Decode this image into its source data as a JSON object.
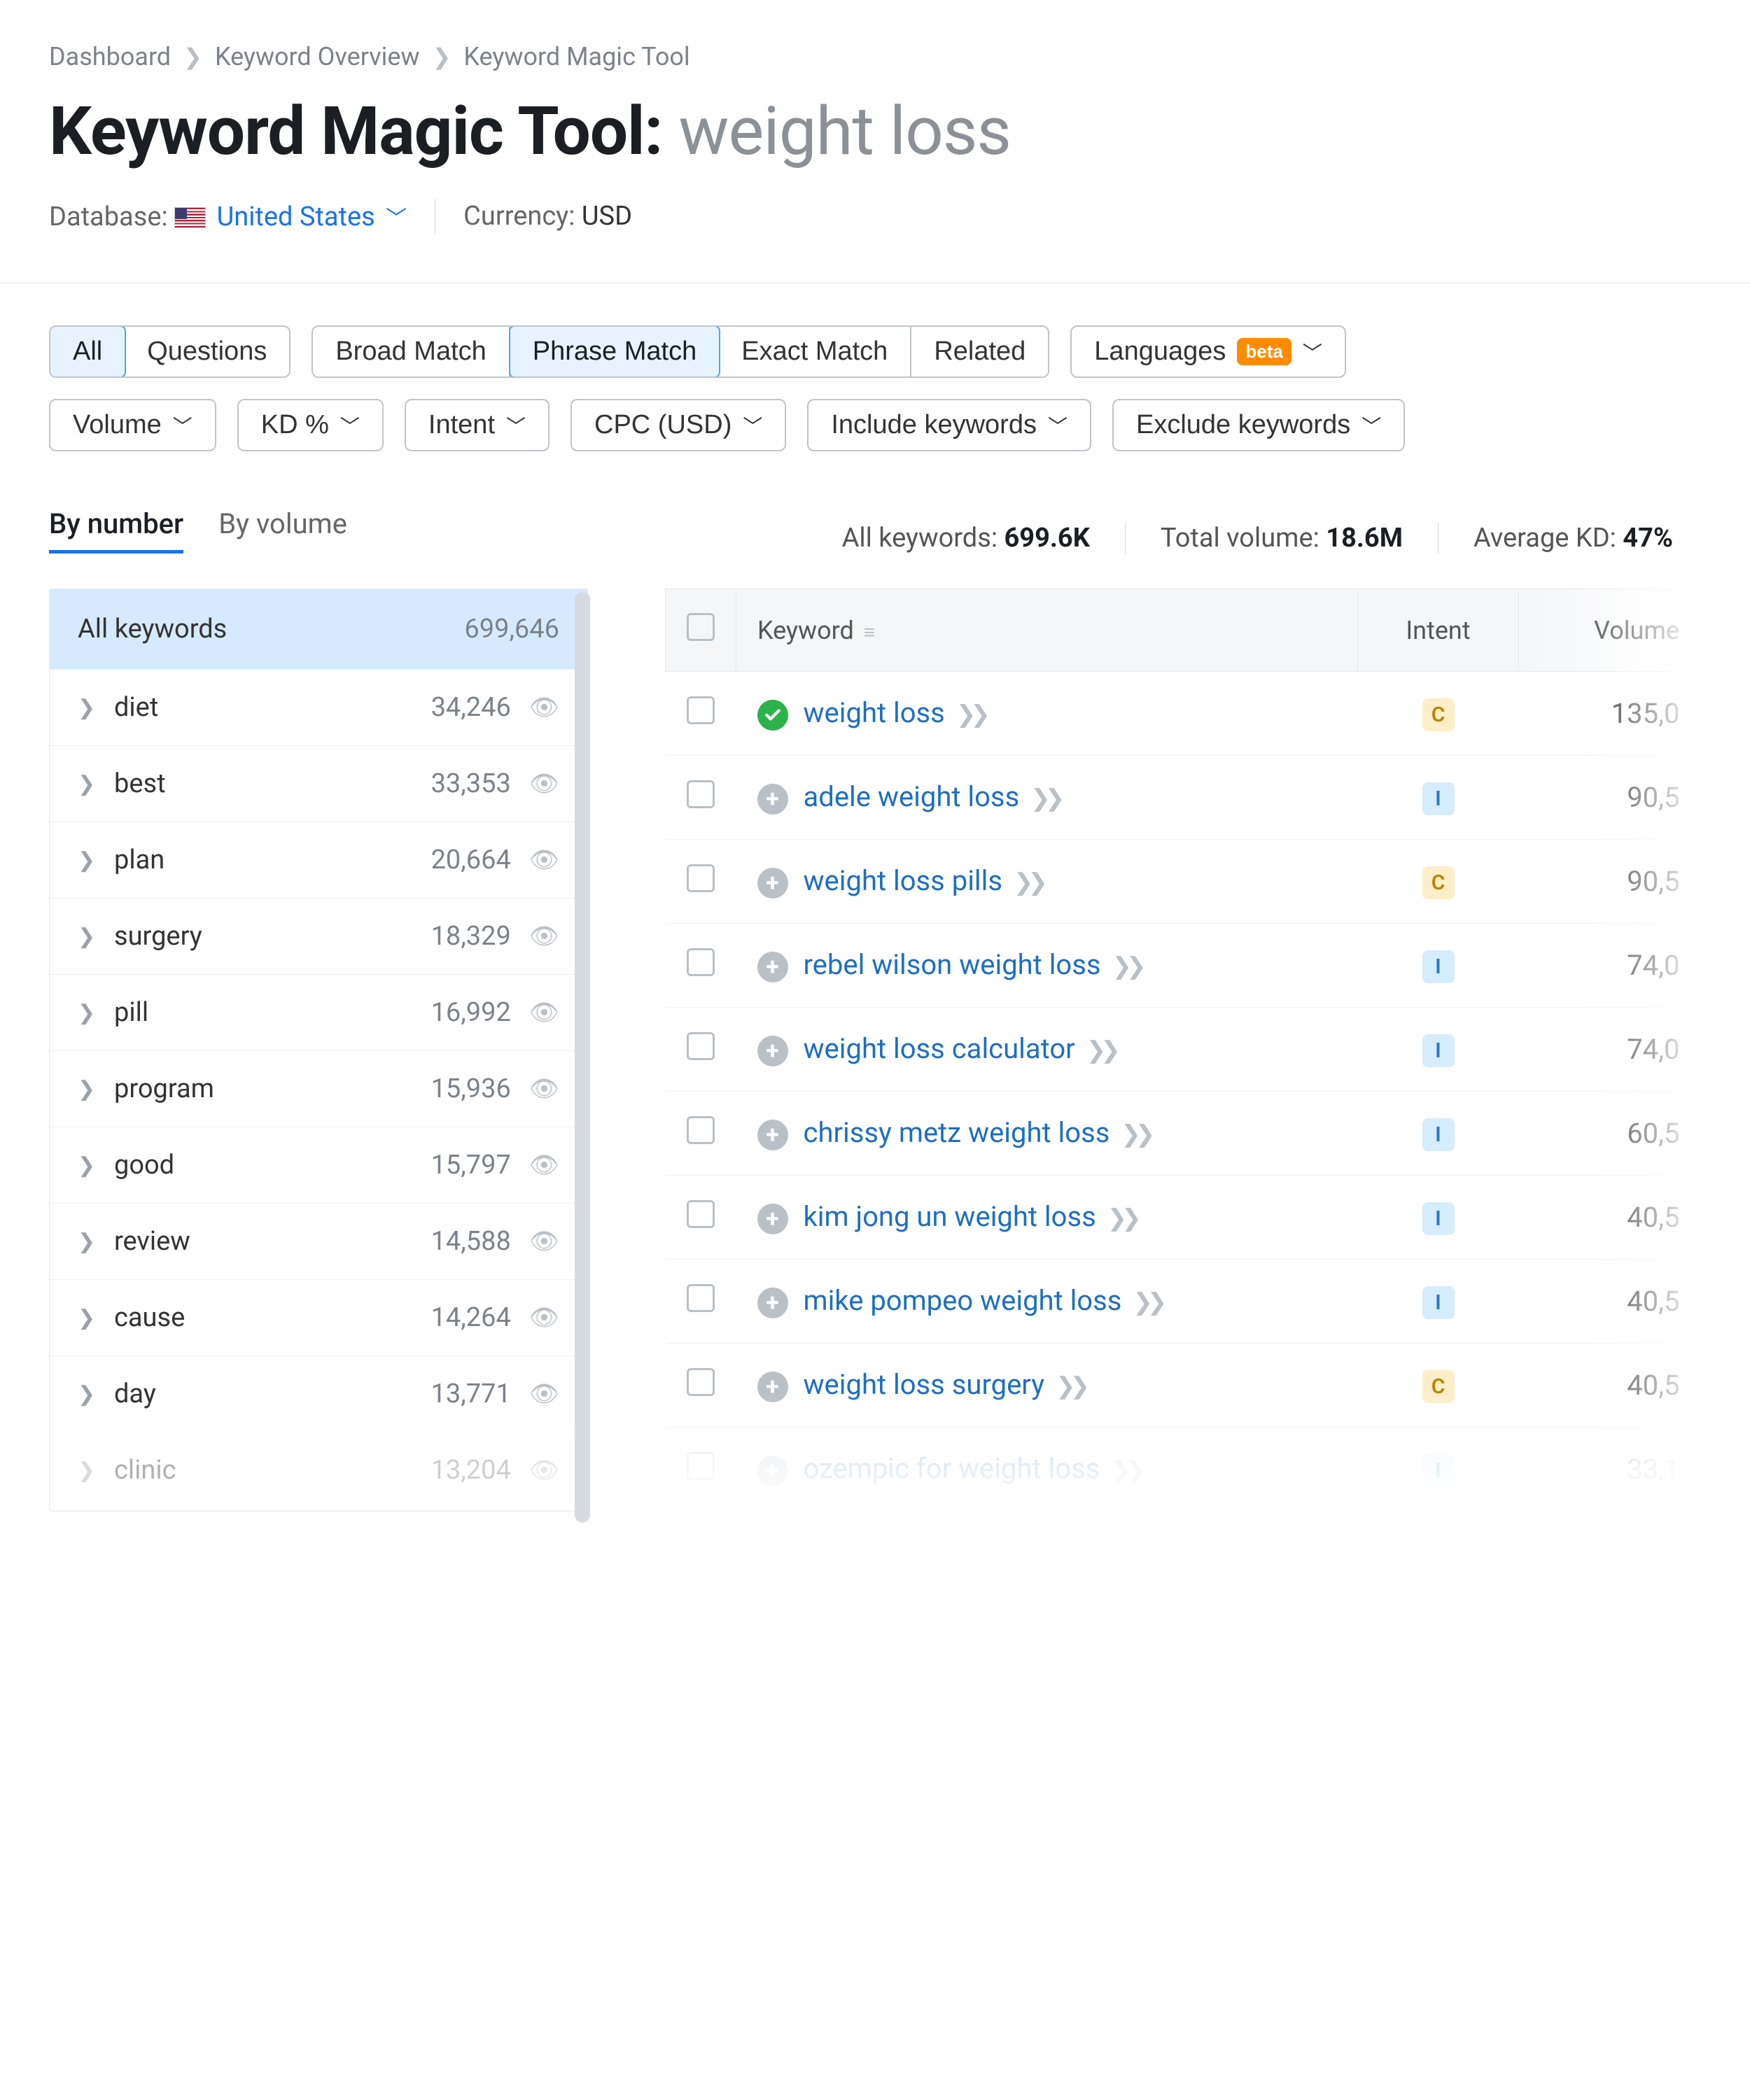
{
  "breadcrumb": [
    "Dashboard",
    "Keyword Overview",
    "Keyword Magic Tool"
  ],
  "title": {
    "prefix": "Keyword Magic Tool:",
    "term": "weight loss"
  },
  "meta": {
    "database_label": "Database:",
    "database_value": "United States",
    "currency_label": "Currency:",
    "currency_value": "USD"
  },
  "filterGroups": {
    "scope": {
      "items": [
        "All",
        "Questions"
      ],
      "active": "All"
    },
    "match": {
      "items": [
        "Broad Match",
        "Phrase Match",
        "Exact Match",
        "Related"
      ],
      "active": "Phrase Match"
    },
    "languages_label": "Languages",
    "beta_label": "beta",
    "dropdowns": [
      "Volume",
      "KD %",
      "Intent",
      "CPC (USD)",
      "Include keywords",
      "Exclude keywords"
    ]
  },
  "sortTabs": {
    "items": [
      "By number",
      "By volume"
    ],
    "active": "By number"
  },
  "stats": {
    "all_keywords_label": "All keywords:",
    "all_keywords_value": "699.6K",
    "total_volume_label": "Total volume:",
    "total_volume_value": "18.6M",
    "avg_kd_label": "Average KD:",
    "avg_kd_value": "47%"
  },
  "sidebar": {
    "head_label": "All keywords",
    "head_count": "699,646",
    "items": [
      {
        "name": "diet",
        "count": "34,246"
      },
      {
        "name": "best",
        "count": "33,353"
      },
      {
        "name": "plan",
        "count": "20,664"
      },
      {
        "name": "surgery",
        "count": "18,329"
      },
      {
        "name": "pill",
        "count": "16,992"
      },
      {
        "name": "program",
        "count": "15,936"
      },
      {
        "name": "good",
        "count": "15,797"
      },
      {
        "name": "review",
        "count": "14,588"
      },
      {
        "name": "cause",
        "count": "14,264"
      },
      {
        "name": "day",
        "count": "13,771"
      },
      {
        "name": "clinic",
        "count": "13,204",
        "faded": true
      }
    ]
  },
  "table": {
    "headers": {
      "keyword": "Keyword",
      "intent": "Intent",
      "volume": "Volume"
    },
    "rows": [
      {
        "kw": "weight loss",
        "intent": "C",
        "vol": "135,0",
        "seed": true
      },
      {
        "kw": "adele weight loss",
        "intent": "I",
        "vol": "90,5"
      },
      {
        "kw": "weight loss pills",
        "intent": "C",
        "vol": "90,5"
      },
      {
        "kw": "rebel wilson weight loss",
        "intent": "I",
        "vol": "74,0"
      },
      {
        "kw": "weight loss calculator",
        "intent": "I",
        "vol": "74,0"
      },
      {
        "kw": "chrissy metz weight loss",
        "intent": "I",
        "vol": "60,5"
      },
      {
        "kw": "kim jong un weight loss",
        "intent": "I",
        "vol": "40,5"
      },
      {
        "kw": "mike pompeo weight loss",
        "intent": "I",
        "vol": "40,5"
      },
      {
        "kw": "weight loss surgery",
        "intent": "C",
        "vol": "40,5"
      },
      {
        "kw": "ozempic for weight loss",
        "intent": "I",
        "vol": "33,1",
        "faded": true
      }
    ]
  }
}
